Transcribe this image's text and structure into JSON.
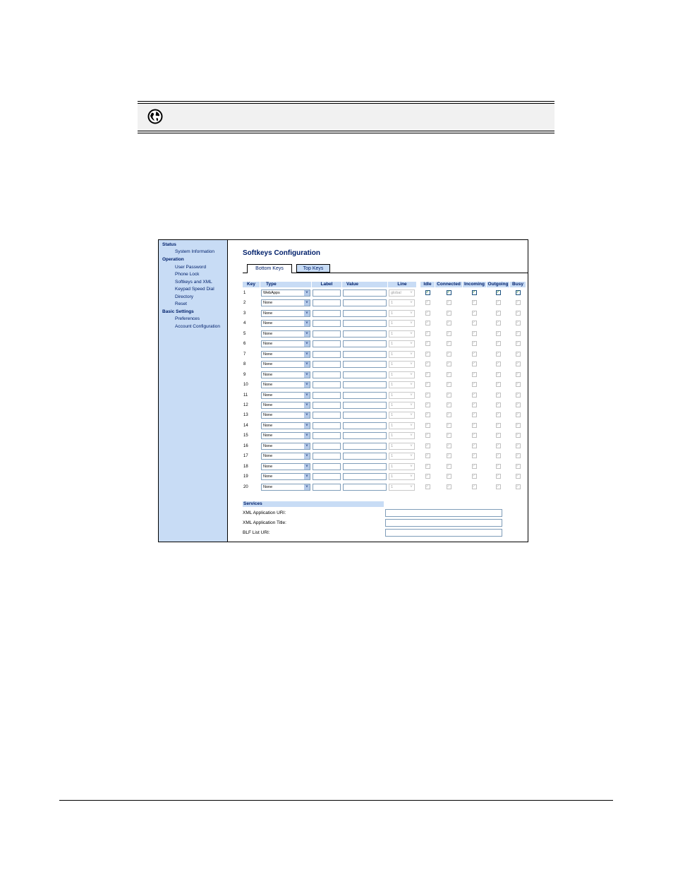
{
  "nav": {
    "sections": [
      {
        "label": "Status",
        "items": [
          "System Information"
        ]
      },
      {
        "label": "Operation",
        "items": [
          "User Password",
          "Phone Lock",
          "Softkeys and XML",
          "Keypad Speed Dial",
          "Directory",
          "Reset"
        ]
      },
      {
        "label": "Basic Settings",
        "items": [
          "Preferences",
          "Account Configuration"
        ]
      }
    ]
  },
  "page_title": "Softkeys Configuration",
  "tabs": {
    "bottom": "Bottom Keys",
    "top": "Top Keys"
  },
  "columns": {
    "key": "Key",
    "type": "Type",
    "label": "Label",
    "value": "Value",
    "line": "Line",
    "idle": "Idle",
    "connected": "Connected",
    "incoming": "Incoming",
    "outgoing": "Outgoing",
    "busy": "Busy"
  },
  "rows": [
    {
      "key": "1",
      "type": "WebApps",
      "line": "global",
      "checked": true,
      "enabled": true
    },
    {
      "key": "2",
      "type": "None",
      "line": "1",
      "checked": true,
      "enabled": false
    },
    {
      "key": "3",
      "type": "None",
      "line": "1",
      "checked": true,
      "enabled": false
    },
    {
      "key": "4",
      "type": "None",
      "line": "1",
      "checked": true,
      "enabled": false
    },
    {
      "key": "5",
      "type": "None",
      "line": "1",
      "checked": true,
      "enabled": false
    },
    {
      "key": "6",
      "type": "None",
      "line": "1",
      "checked": true,
      "enabled": false
    },
    {
      "key": "7",
      "type": "None",
      "line": "1",
      "checked": true,
      "enabled": false
    },
    {
      "key": "8",
      "type": "None",
      "line": "1",
      "checked": true,
      "enabled": false
    },
    {
      "key": "9",
      "type": "None",
      "line": "1",
      "checked": true,
      "enabled": false
    },
    {
      "key": "10",
      "type": "None",
      "line": "1",
      "checked": true,
      "enabled": false
    },
    {
      "key": "11",
      "type": "None",
      "line": "1",
      "checked": true,
      "enabled": false
    },
    {
      "key": "12",
      "type": "None",
      "line": "1",
      "checked": true,
      "enabled": false
    },
    {
      "key": "13",
      "type": "None",
      "line": "1",
      "checked": true,
      "enabled": false
    },
    {
      "key": "14",
      "type": "None",
      "line": "1",
      "checked": true,
      "enabled": false
    },
    {
      "key": "15",
      "type": "None",
      "line": "1",
      "checked": true,
      "enabled": false
    },
    {
      "key": "16",
      "type": "None",
      "line": "1",
      "checked": true,
      "enabled": false
    },
    {
      "key": "17",
      "type": "None",
      "line": "1",
      "checked": true,
      "enabled": false
    },
    {
      "key": "18",
      "type": "None",
      "line": "1",
      "checked": true,
      "enabled": false
    },
    {
      "key": "19",
      "type": "None",
      "line": "1",
      "checked": true,
      "enabled": false
    },
    {
      "key": "20",
      "type": "None",
      "line": "1",
      "checked": true,
      "enabled": false
    }
  ],
  "services": {
    "header": "Services",
    "fields": [
      "XML Application URI:",
      "XML Application Title:",
      "BLF List URI:"
    ]
  },
  "icons": {
    "header": "globe-icon",
    "dropdown": "chevron-down-icon",
    "check": "checkmark-icon"
  },
  "colors": {
    "nav_bg": "#c8dcf5",
    "nav_text": "#00206b",
    "header_bar": "#f1f1f1"
  }
}
